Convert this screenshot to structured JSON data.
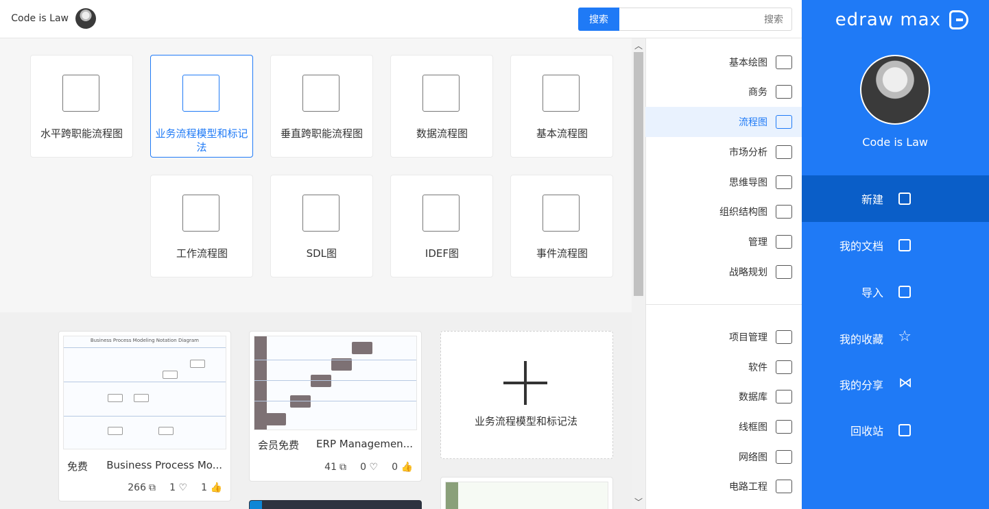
{
  "app": {
    "logo_text": "edraw max",
    "accent": "#1f7af6",
    "active_nav_color": "#0a5ec8"
  },
  "user": {
    "name": "Code is Law"
  },
  "nav": {
    "items": [
      {
        "label": "新建",
        "icon": "plus-square-icon",
        "active": true
      },
      {
        "label": "我的文档",
        "icon": "document-icon",
        "active": false
      },
      {
        "label": "导入",
        "icon": "import-icon",
        "active": false
      },
      {
        "label": "我的收藏",
        "icon": "star-icon",
        "active": false
      },
      {
        "label": "我的分享",
        "icon": "share-icon",
        "active": false
      },
      {
        "label": "回收站",
        "icon": "trash-icon",
        "active": false
      }
    ]
  },
  "search": {
    "placeholder": "搜索",
    "button": "搜索"
  },
  "categories": {
    "group1": [
      {
        "label": "基本绘图",
        "icon": "shapes-icon"
      },
      {
        "label": "商务",
        "icon": "briefcase-icon"
      },
      {
        "label": "流程图",
        "icon": "flowchart-icon",
        "active": true
      },
      {
        "label": "市场分析",
        "icon": "bar-chart-icon"
      },
      {
        "label": "思维导图",
        "icon": "mindmap-icon"
      },
      {
        "label": "组织结构图",
        "icon": "org-chart-icon"
      },
      {
        "label": "管理",
        "icon": "gear-person-icon"
      },
      {
        "label": "战略规划",
        "icon": "strategy-icon"
      }
    ],
    "group2": [
      {
        "label": "项目管理",
        "icon": "gantt-icon"
      },
      {
        "label": "软件",
        "icon": "software-icon"
      },
      {
        "label": "数据库",
        "icon": "database-icon"
      },
      {
        "label": "线框图",
        "icon": "wireframe-icon"
      },
      {
        "label": "网络图",
        "icon": "network-icon"
      },
      {
        "label": "电路工程",
        "icon": "circuit-icon"
      }
    ]
  },
  "templates": [
    {
      "label": "基本流程图",
      "icon": "basic-flowchart-icon"
    },
    {
      "label": "数据流程图",
      "icon": "data-flow-icon"
    },
    {
      "label": "垂直跨职能流程图",
      "icon": "vertical-swimlane-icon"
    },
    {
      "label": "业务流程模型和标记法",
      "icon": "bpmn-icon",
      "active": true
    },
    {
      "label": "水平跨职能流程图",
      "icon": "horizontal-swimlane-icon"
    },
    {
      "label": "事件流程图",
      "icon": "event-flow-icon"
    },
    {
      "label": "IDEF图",
      "icon": "idef-icon"
    },
    {
      "label": "SDL图",
      "icon": "sdl-icon"
    },
    {
      "label": "工作流程图",
      "icon": "workflow-icon"
    }
  ],
  "examples": {
    "new_label": "业务流程模型和标记法",
    "cards": [
      {
        "title": "ERP Managemen...",
        "tag": "会员免费",
        "likes": "0",
        "favorites": "0",
        "copies": "41"
      },
      {
        "title": "Business Process Mo...",
        "tag": "免费",
        "likes": "1",
        "favorites": "1",
        "copies": "266",
        "thumb_caption": "Business Process Modeling Notation Diagram"
      }
    ]
  }
}
